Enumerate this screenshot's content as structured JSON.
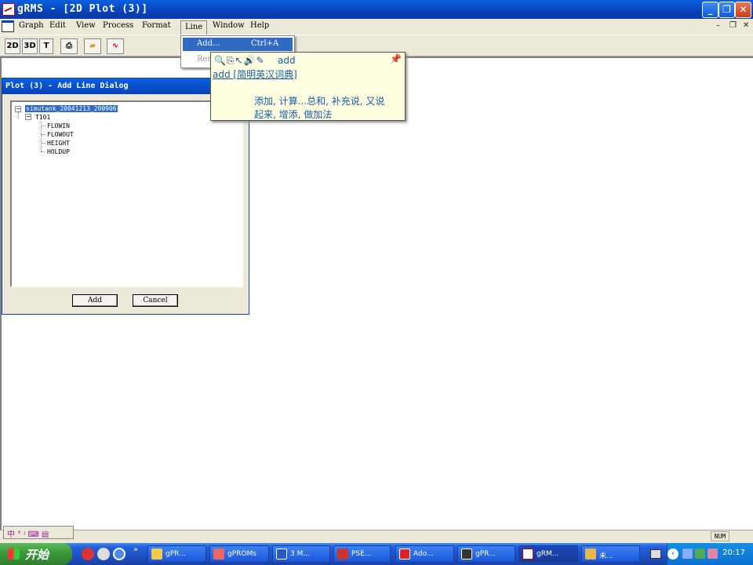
{
  "window": {
    "title": "gRMS - [2D Plot (3)]"
  },
  "menubar": {
    "items": [
      "Graph",
      "Edit",
      "View",
      "Process",
      "Format",
      "Line",
      "Window",
      "Help"
    ],
    "mdi_controls": [
      "–",
      "❐",
      "✕"
    ]
  },
  "toolbar": {
    "btn_2d": "2D",
    "btn_3d": "3D",
    "btn_t": "T"
  },
  "line_menu": {
    "add_label": "Add...",
    "add_shortcut": "Ctrl+A",
    "remove_label": "Rem"
  },
  "dictionary_popup": {
    "word": "add",
    "source": "add [简明英汉词典]",
    "definition_1": "添加, 计算...总和, 补充说, 又说",
    "definition_2": "起来, 增添, 做加法"
  },
  "dialog": {
    "title": "Plot (3) - Add Line Dialog",
    "tree": {
      "root": "simutank_20041213_200906",
      "child": "T101",
      "leaves": [
        "FLOWIN",
        "FLOWOUT",
        "HEIGHT",
        "HOLDUP"
      ]
    },
    "add_button": "Add",
    "cancel_button": "Cancel"
  },
  "statusbar": {
    "num": "NUM"
  },
  "taskbar": {
    "start": "开始",
    "tasks": [
      "gPR...",
      "gPROMs",
      "3 M...",
      "PSE...",
      "Ado...",
      "gPR...",
      "gRM...",
      "未..."
    ],
    "clock": "20:17"
  }
}
